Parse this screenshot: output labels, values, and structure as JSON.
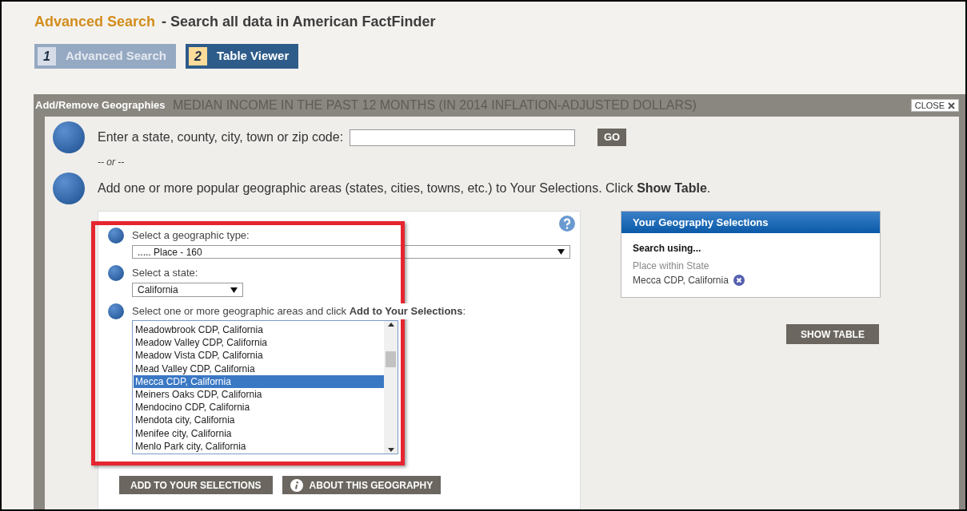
{
  "header": {
    "title_accent": "Advanced Search",
    "title_rest": "- Search all data in American FactFinder"
  },
  "steps": [
    {
      "number": "1",
      "label": "Advanced Search",
      "selected": false
    },
    {
      "number": "2",
      "label": "Table Viewer",
      "selected": true
    }
  ],
  "modal": {
    "title": "Add/Remove Geographies",
    "background_title": "MEDIAN INCOME IN THE PAST 12 MONTHS (IN 2014 INFLATION-ADJUSTED DOLLARS)",
    "close": "CLOSE",
    "search_prompt": "Enter a state, county, city, town or zip code:",
    "go": "GO",
    "or": "-- or --",
    "popular_text": "Add one or more popular geographic areas (states, cities, towns, etc.) to Your Selections. Click **Show Table**.",
    "type_label": "Select a geographic type:",
    "type_value": "..... Place - 160",
    "state_label": "Select a state:",
    "state_value": "California",
    "areas_label": "Select one or more geographic areas and click **Add to Your Selections**:",
    "areas": [
      {
        "label": "Meadowbrook CDP, California",
        "selected": false
      },
      {
        "label": "Meadow Valley CDP, California",
        "selected": false
      },
      {
        "label": "Meadow Vista CDP, California",
        "selected": false
      },
      {
        "label": "Mead Valley CDP, California",
        "selected": false
      },
      {
        "label": "Mecca CDP, California",
        "selected": true
      },
      {
        "label": "Meiners Oaks CDP, California",
        "selected": false
      },
      {
        "label": "Mendocino CDP, California",
        "selected": false
      },
      {
        "label": "Mendota city, California",
        "selected": false
      },
      {
        "label": "Menifee city, California",
        "selected": false
      },
      {
        "label": "Menlo Park city, California",
        "selected": false
      }
    ],
    "add_button": "ADD TO YOUR SELECTIONS",
    "about_button": "ABOUT THIS GEOGRAPHY",
    "selections": {
      "title": "Your Geography Selections",
      "subtitle": "Search using...",
      "group": "Place within State",
      "items": [
        "Mecca CDP, California"
      ]
    },
    "show_table": "SHOW TABLE"
  }
}
